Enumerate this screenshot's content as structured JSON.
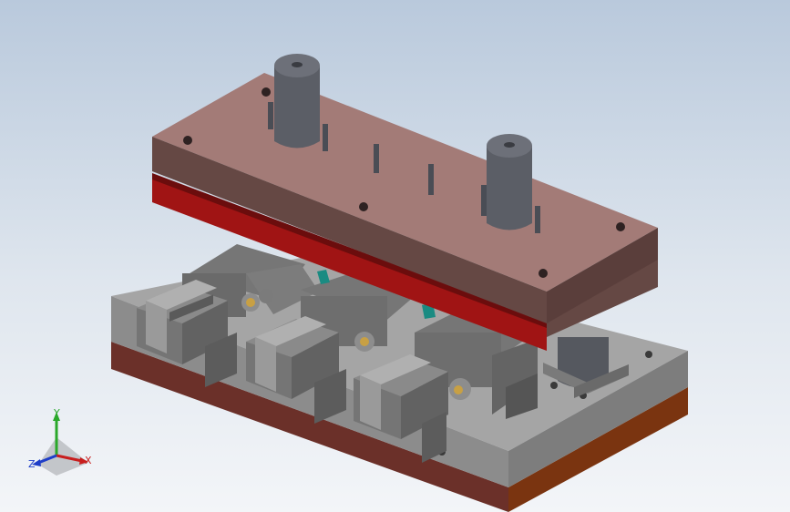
{
  "viewport": {
    "background_top": "#b9c9dc",
    "background_bottom": "#f3f5f8"
  },
  "model": {
    "colors": {
      "top_plate_face": "#a37b77",
      "top_plate_side": "#654844",
      "red_plate_face": "#a01414",
      "red_plate_side": "#6b0d0d",
      "base_top": "#9a9a9a",
      "base_side": "#7d7d7d",
      "base_bottom_front": "#6b3029",
      "base_bottom_side": "#7a3410",
      "cylinder": "#5b5e66",
      "cylinder_dark": "#41444b",
      "cylinder_top": "#6d7079",
      "actuator": "#6e6e6e",
      "actuator_light": "#8d8d8d",
      "teal": "#1a8b82",
      "brass": "#c8a044"
    }
  },
  "triad": {
    "x_label": "X",
    "y_label": "Y",
    "z_label": "Z",
    "x_color": "#c81e1e",
    "y_color": "#2aa82a",
    "z_color": "#1e3ec8"
  }
}
